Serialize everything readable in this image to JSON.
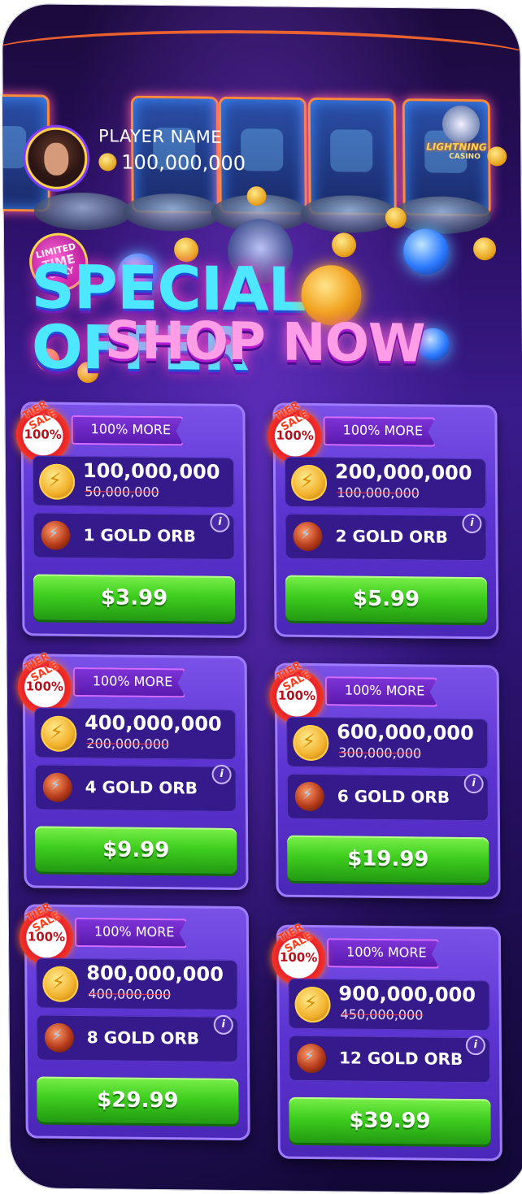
{
  "player": {
    "name": "PLAYER NAME",
    "coins": "100,000,000"
  },
  "logo": {
    "title": "LIGHTNING",
    "subtitle": "CASINO"
  },
  "promo": {
    "badge_line1": "LIMITED",
    "badge_line2": "TIME",
    "badge_line3": "ONLY",
    "title": "SPECIAL OFFER",
    "subtitle": "SHOP NOW"
  },
  "offers": [
    {
      "burst": "100%",
      "sale": "TIER SALE",
      "tag": "100% MORE",
      "coins": "100,000,000",
      "old_coins": "50,000,000",
      "orbs": "1 GOLD ORB",
      "price": "$3.99"
    },
    {
      "burst": "100%",
      "sale": "TIER SALE",
      "tag": "100% MORE",
      "coins": "200,000,000",
      "old_coins": "100,000,000",
      "orbs": "2 GOLD ORB",
      "price": "$5.99"
    },
    {
      "burst": "100%",
      "sale": "TIER SALE",
      "tag": "100% MORE",
      "coins": "400,000,000",
      "old_coins": "200,000,000",
      "orbs": "4 GOLD ORB",
      "price": "$9.99"
    },
    {
      "burst": "100%",
      "sale": "TIER SALE",
      "tag": "100% MORE",
      "coins": "600,000,000",
      "old_coins": "300,000,000",
      "orbs": "6 GOLD ORB",
      "price": "$19.99"
    },
    {
      "burst": "100%",
      "sale": "TIER SALE",
      "tag": "100% MORE",
      "coins": "800,000,000",
      "old_coins": "400,000,000",
      "orbs": "8 GOLD ORB",
      "price": "$29.99"
    },
    {
      "burst": "100%",
      "sale": "TIER SALE",
      "tag": "100% MORE",
      "coins": "900,000,000",
      "old_coins": "450,000,000",
      "orbs": "12 GOLD ORB",
      "price": "$39.99"
    }
  ],
  "info_icon": "i",
  "colors": {
    "buy_button": "#3fce1f",
    "card": "#5c34d2",
    "title_cyan": "#4de8ff",
    "title_pink": "#ff9ee6"
  }
}
